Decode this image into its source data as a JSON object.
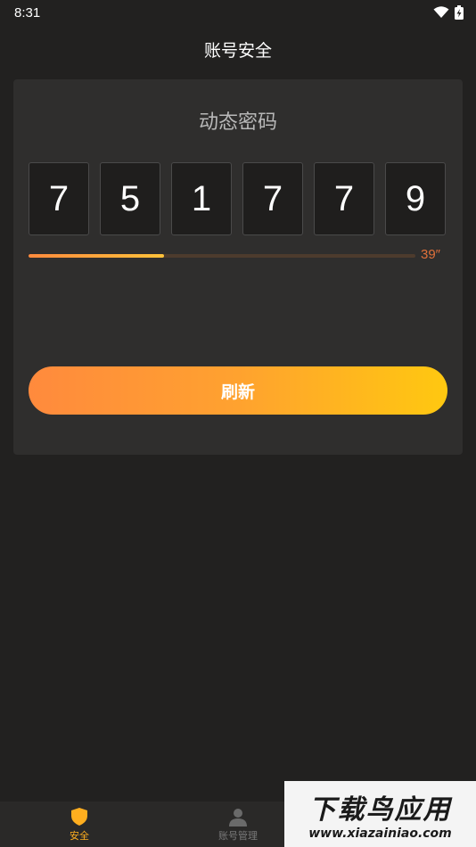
{
  "status_bar": {
    "time": "8:31",
    "icons": [
      "wifi-icon",
      "battery-charging-icon"
    ]
  },
  "header": {
    "title": "账号安全"
  },
  "card": {
    "title": "动态密码",
    "digits": [
      "7",
      "5",
      "1",
      "7",
      "7",
      "9"
    ],
    "progress_fraction": 0.35,
    "countdown": "39″",
    "refresh_label": "刷新"
  },
  "colors": {
    "accent_start": "#ff8a3d",
    "accent_end": "#ffc810",
    "countdown": "#e0703a",
    "nav_active": "#ffae1f"
  },
  "bottom_nav": {
    "items": [
      {
        "label": "安全",
        "icon": "shield-icon",
        "active": true
      },
      {
        "label": "账号管理",
        "icon": "user-icon",
        "active": false
      }
    ]
  },
  "watermark": {
    "main": "下载鸟应用",
    "sub": "www.xiazainiao.com"
  }
}
